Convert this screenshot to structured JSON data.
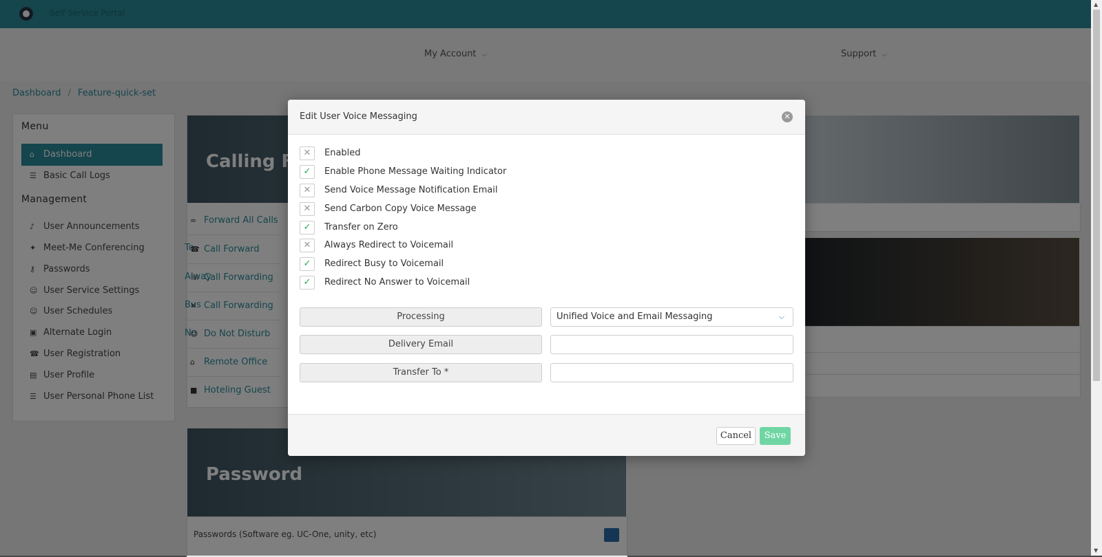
{
  "topbar": {
    "title": "Self Service Portal"
  },
  "nav": {
    "my_account": "My Account",
    "support": "Support"
  },
  "breadcrumb": {
    "home": "Dashboard",
    "current": "Feature-quick-set",
    "sep": "/"
  },
  "sidebar": {
    "menu_heading": "Menu",
    "management_heading": "Management",
    "menu_items": [
      {
        "label": "Dashboard",
        "icon": "home-icon"
      },
      {
        "label": "Basic Call Logs",
        "icon": "list-icon"
      }
    ],
    "management_items": [
      {
        "label": "User Announcements",
        "icon": "volume-icon"
      },
      {
        "label": "Meet-Me Conferencing",
        "icon": "handshake-icon"
      },
      {
        "label": "Passwords",
        "icon": "key-icon"
      },
      {
        "label": "User Service Settings",
        "icon": "user-gear-icon"
      },
      {
        "label": "User Schedules",
        "icon": "user-clock-icon"
      },
      {
        "label": "Alternate Login",
        "icon": "id-icon"
      },
      {
        "label": "User Registration",
        "icon": "phone-icon"
      },
      {
        "label": "User Profile",
        "icon": "profile-card-icon"
      },
      {
        "label": "User Personal Phone List",
        "icon": "list-icon"
      }
    ]
  },
  "cards": {
    "calling_title": "Calling Fe",
    "features": [
      "Forward All Calls To",
      "Call Forward Alway",
      "Call Forwarding Bus",
      "Call Forwarding No",
      "Do Not Disturb",
      "Remote Office",
      "Hoteling Guest"
    ],
    "password_title": "Password",
    "password_row": "Passwords (Software eg. UC-One, unity, etc)"
  },
  "modal": {
    "title": "Edit User Voice Messaging",
    "checkboxes": [
      {
        "label": "Enabled",
        "checked": false
      },
      {
        "label": "Enable Phone Message Waiting Indicator",
        "checked": true
      },
      {
        "label": "Send Voice Message Notification Email",
        "checked": false
      },
      {
        "label": "Send Carbon Copy Voice Message",
        "checked": false
      },
      {
        "label": "Transfer on Zero",
        "checked": true
      },
      {
        "label": "Always Redirect to Voicemail",
        "checked": false
      },
      {
        "label": "Redirect Busy to Voicemail",
        "checked": true
      },
      {
        "label": "Redirect No Answer to Voicemail",
        "checked": true
      }
    ],
    "processing_label": "Processing",
    "processing_value": "Unified Voice and Email Messaging",
    "delivery_email_label": "Delivery Email",
    "delivery_email_value": "",
    "transfer_to_label": "Transfer To *",
    "transfer_to_value": "",
    "cancel_label": "Cancel",
    "save_label": "Save"
  },
  "colors": {
    "brand": "#2a8a9a",
    "save": "#6fd6a3",
    "check": "#22aa55"
  }
}
